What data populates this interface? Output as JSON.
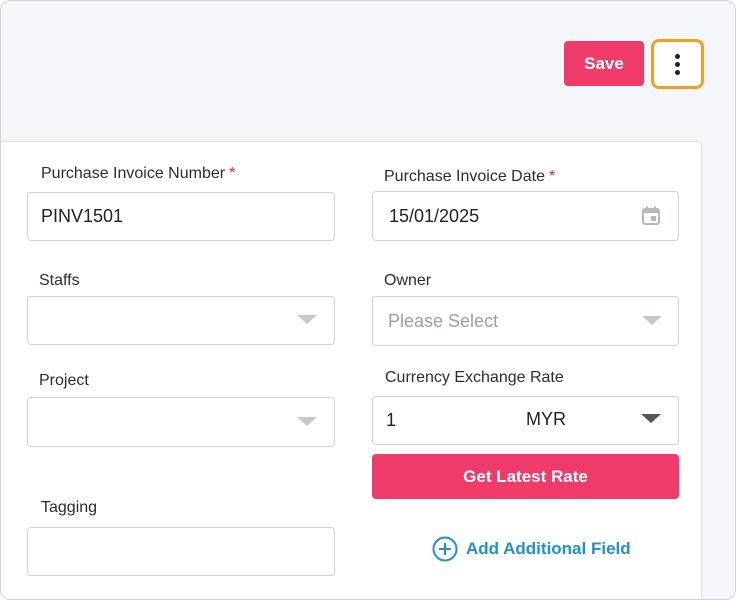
{
  "header": {
    "save_label": "Save",
    "more_icon": "more-vertical-icon"
  },
  "form": {
    "invoice_number": {
      "label": "Purchase Invoice Number",
      "required_mark": "*",
      "value": "PINV1501"
    },
    "invoice_date": {
      "label": "Purchase Invoice Date",
      "required_mark": "*",
      "value": "15/01/2025",
      "icon": "calendar-icon"
    },
    "staffs": {
      "label": "Staffs",
      "value": ""
    },
    "owner": {
      "label": "Owner",
      "placeholder": "Please Select"
    },
    "project": {
      "label": "Project",
      "value": ""
    },
    "currency": {
      "label": "Currency Exchange Rate",
      "rate": "1",
      "currency": "MYR"
    },
    "get_latest_rate_label": "Get Latest Rate",
    "tagging": {
      "label": "Tagging",
      "value": ""
    },
    "add_field_label": "Add Additional Field"
  },
  "colors": {
    "accent": "#ef3b69",
    "link": "#2290cf",
    "focus_outline": "#f0a020"
  }
}
